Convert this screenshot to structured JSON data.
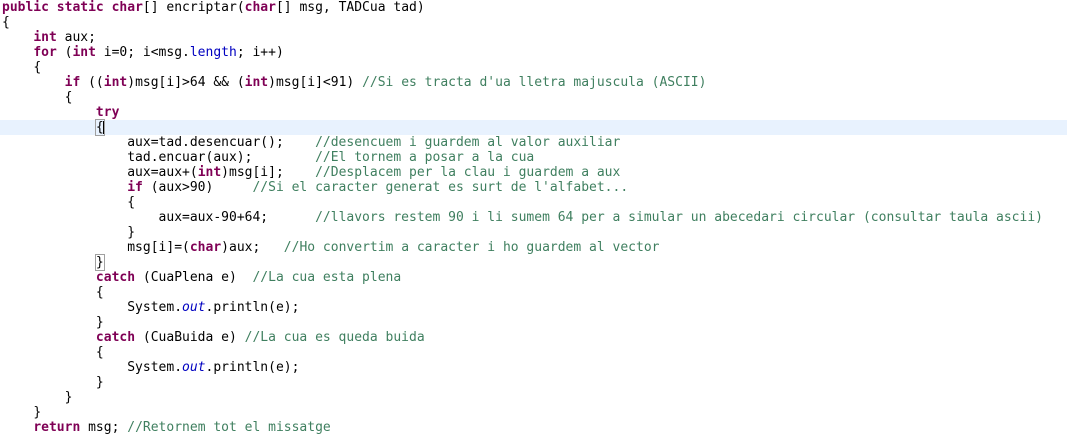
{
  "editor": {
    "lines": [
      {
        "indent": "",
        "parts": [
          {
            "t": "kw",
            "v": "public"
          },
          {
            "t": "tx",
            "v": " "
          },
          {
            "t": "kw",
            "v": "static"
          },
          {
            "t": "tx",
            "v": " "
          },
          {
            "t": "kw",
            "v": "char"
          },
          {
            "t": "tx",
            "v": "[] encriptar("
          },
          {
            "t": "kw",
            "v": "char"
          },
          {
            "t": "tx",
            "v": "[] msg, TADCua tad)"
          }
        ]
      },
      {
        "indent": "",
        "parts": [
          {
            "t": "tx",
            "v": "{"
          }
        ]
      },
      {
        "indent": "    ",
        "parts": [
          {
            "t": "kw",
            "v": "int"
          },
          {
            "t": "tx",
            "v": " aux;"
          }
        ]
      },
      {
        "indent": "    ",
        "parts": [
          {
            "t": "kw",
            "v": "for"
          },
          {
            "t": "tx",
            "v": " ("
          },
          {
            "t": "kw",
            "v": "int"
          },
          {
            "t": "tx",
            "v": " i=0; i<msg."
          },
          {
            "t": "fl",
            "v": "length"
          },
          {
            "t": "tx",
            "v": "; i++)"
          }
        ]
      },
      {
        "indent": "    ",
        "parts": [
          {
            "t": "tx",
            "v": "{"
          }
        ]
      },
      {
        "indent": "        ",
        "parts": [
          {
            "t": "kw",
            "v": "if"
          },
          {
            "t": "tx",
            "v": " (("
          },
          {
            "t": "kw",
            "v": "int"
          },
          {
            "t": "tx",
            "v": ")msg[i]>64 && ("
          },
          {
            "t": "kw",
            "v": "int"
          },
          {
            "t": "tx",
            "v": ")msg[i]<91) "
          },
          {
            "t": "cm",
            "v": "//Si es tracta d'ua lletra majuscula (ASCII)"
          }
        ]
      },
      {
        "indent": "        ",
        "parts": [
          {
            "t": "tx",
            "v": "{"
          }
        ]
      },
      {
        "indent": "            ",
        "parts": [
          {
            "t": "kw",
            "v": "try"
          }
        ]
      },
      {
        "indent": "            ",
        "current": true,
        "parts": [
          {
            "t": "br",
            "v": "{"
          },
          {
            "t": "caret",
            "v": ""
          }
        ]
      },
      {
        "indent": "                ",
        "parts": [
          {
            "t": "tx",
            "v": "aux=tad.desencuar();    "
          },
          {
            "t": "cm",
            "v": "//desencuem i guardem al valor auxiliar"
          }
        ]
      },
      {
        "indent": "                ",
        "parts": [
          {
            "t": "tx",
            "v": "tad.encuar(aux);        "
          },
          {
            "t": "cm",
            "v": "//El tornem a posar a la cua"
          }
        ]
      },
      {
        "indent": "                ",
        "parts": [
          {
            "t": "tx",
            "v": "aux=aux+("
          },
          {
            "t": "kw",
            "v": "int"
          },
          {
            "t": "tx",
            "v": ")msg[i];    "
          },
          {
            "t": "cm",
            "v": "//Desplacem per la clau i guardem a aux"
          }
        ]
      },
      {
        "indent": "                ",
        "parts": [
          {
            "t": "kw",
            "v": "if"
          },
          {
            "t": "tx",
            "v": " (aux>90)     "
          },
          {
            "t": "cm",
            "v": "//Si el caracter generat es surt de l'alfabet..."
          }
        ]
      },
      {
        "indent": "                ",
        "parts": [
          {
            "t": "tx",
            "v": "{"
          }
        ]
      },
      {
        "indent": "                    ",
        "parts": [
          {
            "t": "tx",
            "v": "aux=aux-90+64;      "
          },
          {
            "t": "cm",
            "v": "//llavors restem 90 i li sumem 64 per a simular un abecedari circular (consultar taula ascii)"
          }
        ]
      },
      {
        "indent": "                ",
        "parts": [
          {
            "t": "tx",
            "v": "}"
          }
        ]
      },
      {
        "indent": "                ",
        "parts": [
          {
            "t": "tx",
            "v": "msg[i]=("
          },
          {
            "t": "kw",
            "v": "char"
          },
          {
            "t": "tx",
            "v": ")aux;   "
          },
          {
            "t": "cm",
            "v": "//Ho convertim a caracter i ho guardem al vector"
          }
        ]
      },
      {
        "indent": "            ",
        "parts": [
          {
            "t": "br",
            "v": "}"
          }
        ]
      },
      {
        "indent": "            ",
        "parts": [
          {
            "t": "kw",
            "v": "catch"
          },
          {
            "t": "tx",
            "v": " (CuaPlena e)  "
          },
          {
            "t": "cm",
            "v": "//La cua esta plena"
          }
        ]
      },
      {
        "indent": "            ",
        "parts": [
          {
            "t": "tx",
            "v": "{"
          }
        ]
      },
      {
        "indent": "                ",
        "parts": [
          {
            "t": "tx",
            "v": "System."
          },
          {
            "t": "st",
            "v": "out"
          },
          {
            "t": "tx",
            "v": ".println(e);"
          }
        ]
      },
      {
        "indent": "            ",
        "parts": [
          {
            "t": "tx",
            "v": "}"
          }
        ]
      },
      {
        "indent": "            ",
        "parts": [
          {
            "t": "kw",
            "v": "catch"
          },
          {
            "t": "tx",
            "v": " (CuaBuida e) "
          },
          {
            "t": "cm",
            "v": "//La cua es queda buida"
          }
        ]
      },
      {
        "indent": "            ",
        "parts": [
          {
            "t": "tx",
            "v": "{"
          }
        ]
      },
      {
        "indent": "                ",
        "parts": [
          {
            "t": "tx",
            "v": "System."
          },
          {
            "t": "st",
            "v": "out"
          },
          {
            "t": "tx",
            "v": ".println(e);"
          }
        ]
      },
      {
        "indent": "            ",
        "parts": [
          {
            "t": "tx",
            "v": "}"
          }
        ]
      },
      {
        "indent": "        ",
        "parts": [
          {
            "t": "tx",
            "v": "}"
          }
        ]
      },
      {
        "indent": "    ",
        "parts": [
          {
            "t": "tx",
            "v": "}"
          }
        ]
      },
      {
        "indent": "    ",
        "parts": [
          {
            "t": "kw",
            "v": "return"
          },
          {
            "t": "tx",
            "v": " msg; "
          },
          {
            "t": "cm",
            "v": "//Retornem tot el missatge"
          }
        ]
      }
    ]
  }
}
